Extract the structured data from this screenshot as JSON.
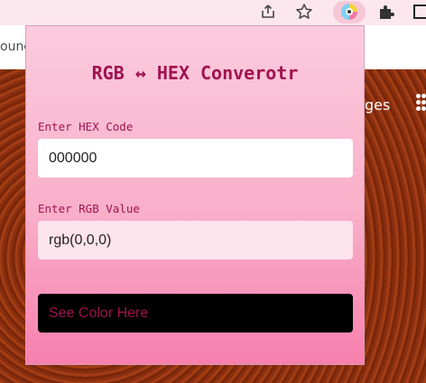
{
  "browser": {
    "icons": [
      "share-icon",
      "star-icon",
      "extension-rgb-icon",
      "puzzle-icon",
      "sidebar-icon"
    ],
    "bookmark_partial": "ounc"
  },
  "page": {
    "partial_link": "ges"
  },
  "popup": {
    "title": "RGB ↔ HEX Converotr",
    "hex_label": "Enter HEX Code",
    "hex_value": "000000",
    "rgb_label": "Enter RGB Value",
    "rgb_value": "rgb(0,0,0)",
    "color_box_label": "See Color Here",
    "preview_color": "#000000",
    "accent_color": "#a0124f"
  }
}
